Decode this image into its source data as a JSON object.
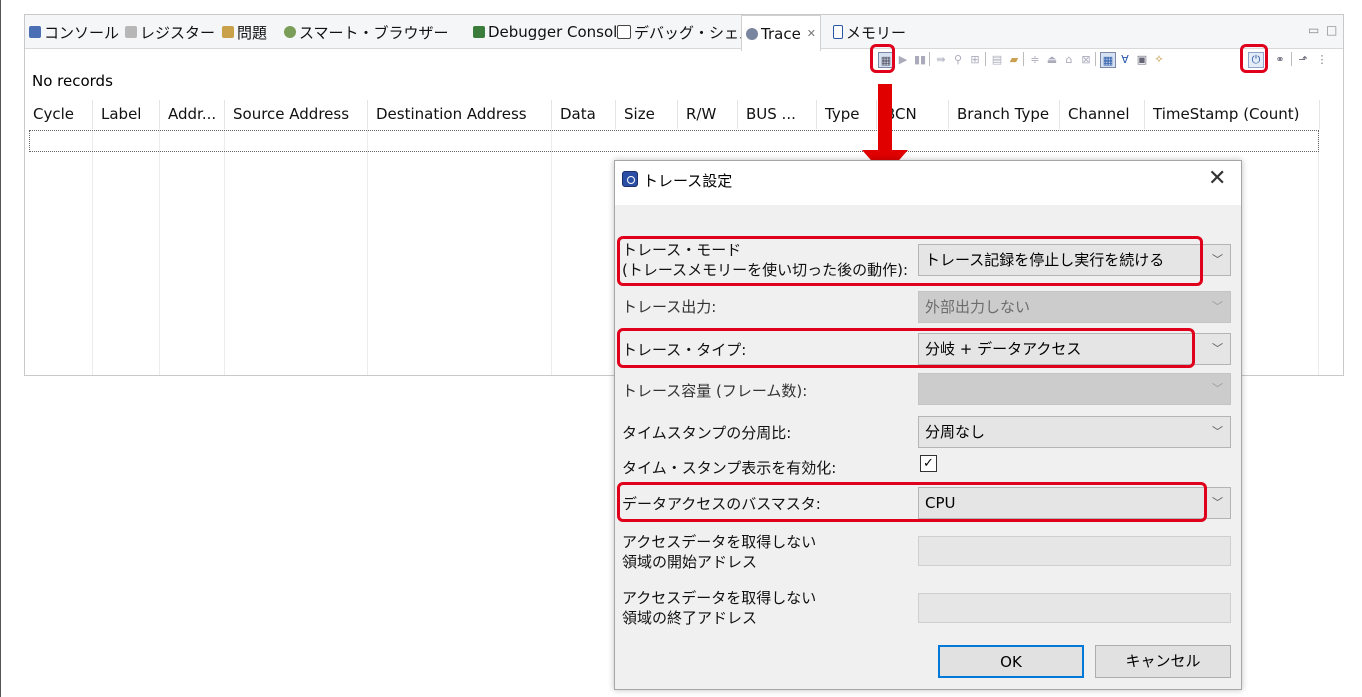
{
  "tabs": [
    {
      "label": "コンソール",
      "active": false
    },
    {
      "label": "レジスター",
      "active": false
    },
    {
      "label": "問題",
      "active": false
    },
    {
      "label": "スマート・ブラウザー",
      "active": false
    },
    {
      "label": "Debugger Console",
      "active": false
    },
    {
      "label": "デバッグ・シェル",
      "active": false
    },
    {
      "label": "Trace",
      "active": true,
      "close": "✕"
    },
    {
      "label": "メモリー",
      "active": false
    }
  ],
  "window_controls": {
    "minimize": "▭",
    "maximize": "□"
  },
  "trace_view": {
    "status": "No records",
    "columns": [
      "Cycle",
      "Label",
      "Addr...",
      "Source Address",
      "Destination Address",
      "Data",
      "Size",
      "R/W",
      "BUS ...",
      "Type",
      "BCN",
      "Branch Type",
      "Channel",
      "TimeStamp (Count)"
    ]
  },
  "dialog": {
    "title": "トレース設定",
    "close": "✕",
    "fields": [
      {
        "label_line1": "トレース・モード",
        "label_line2": "(トレースメモリーを使い切った後の動作):",
        "value": "トレース記録を停止し実行を続ける",
        "enabled": true
      },
      {
        "label": "トレース出力:",
        "value": "外部出力しない",
        "enabled": false
      },
      {
        "label": "トレース・タイプ:",
        "value": "分岐 + データアクセス",
        "enabled": true
      },
      {
        "label": "トレース容量 (フレーム数):",
        "value": "",
        "enabled": false
      },
      {
        "label": "タイムスタンプの分周比:",
        "value": "分周なし",
        "enabled": true
      },
      {
        "label": "タイム・スタンプ表示を有効化:",
        "checked": true
      },
      {
        "label": "データアクセスのバスマスタ:",
        "value": "CPU",
        "enabled": true
      },
      {
        "label_line1": "アクセスデータを取得しない",
        "label_line2": "領域の開始アドレス",
        "value": ""
      },
      {
        "label_line1": "アクセスデータを取得しない",
        "label_line2": "領域の終了アドレス",
        "value": ""
      }
    ],
    "ok_label": "OK",
    "cancel_label": "キャンセル"
  },
  "colors": {
    "highlight": "#e0001b",
    "arrow": "#e00000",
    "ok_border": "#0078d7"
  }
}
